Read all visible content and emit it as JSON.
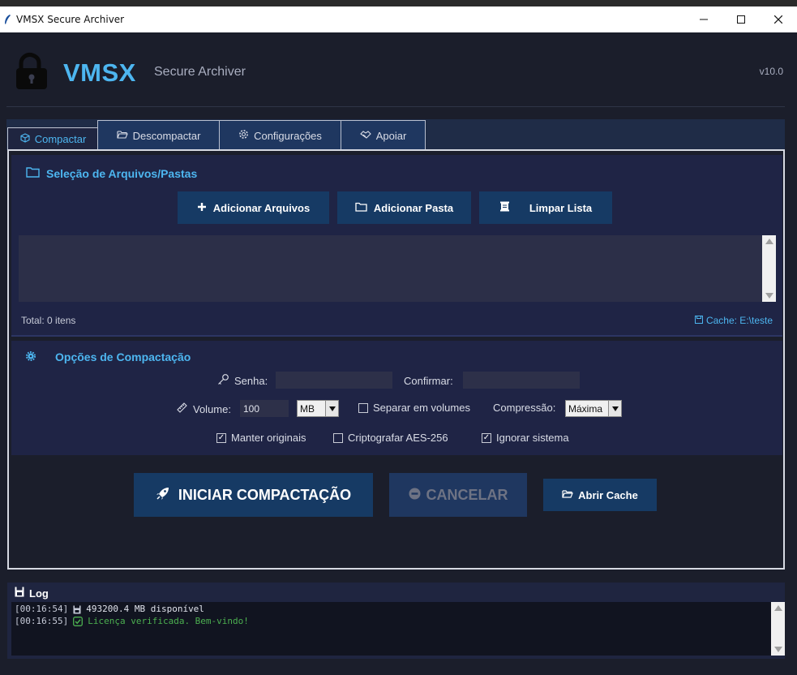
{
  "window": {
    "title": "VMSX Secure Archiver"
  },
  "header": {
    "brand": "VMSX",
    "subtitle": "Secure Archiver",
    "version": "v10.0"
  },
  "tabs": [
    {
      "label": "Compactar",
      "icon": "cube-icon",
      "active": true
    },
    {
      "label": "Descompactar",
      "icon": "folder-open-icon"
    },
    {
      "label": "Configurações",
      "icon": "gear-icon"
    },
    {
      "label": "Apoiar",
      "icon": "handshake-icon"
    }
  ],
  "files": {
    "title": "Seleção de Arquivos/Pastas",
    "add_files": "Adicionar Arquivos",
    "add_folder": "Adicionar Pasta",
    "clear_list": "Limpar Lista",
    "total": "Total: 0 itens",
    "cache": "Cache: E:\\teste"
  },
  "options": {
    "title": "Opções de Compactação",
    "password_label": "Senha:",
    "confirm_label": "Confirmar:",
    "volume_label": "Volume:",
    "volume_value": "100",
    "unit_value": "MB",
    "split_label": "Separar em volumes",
    "split_checked": false,
    "compression_label": "Compressão:",
    "compression_value": "Máxima",
    "keep_originals": "Manter originais",
    "keep_originals_checked": true,
    "encrypt": "Criptografar AES-256",
    "encrypt_checked": false,
    "ignore_system": "Ignorar sistema",
    "ignore_system_checked": true
  },
  "actions": {
    "start": "INICIAR COMPACTAÇÃO",
    "cancel": "CANCELAR",
    "open_cache": "Abrir Cache"
  },
  "log": {
    "title": "Log",
    "lines": [
      {
        "time": "[00:16:54]",
        "text": "493200.4 MB disponível",
        "icon": "floppy-icon"
      },
      {
        "time": "[00:16:55]",
        "text": "Licença verificada. Bem-vindo!",
        "icon": "check-icon"
      }
    ]
  },
  "colors": {
    "accent": "#4db6f0",
    "button": "#163a64",
    "background": "#1b1e2b",
    "success": "#4caf50"
  }
}
